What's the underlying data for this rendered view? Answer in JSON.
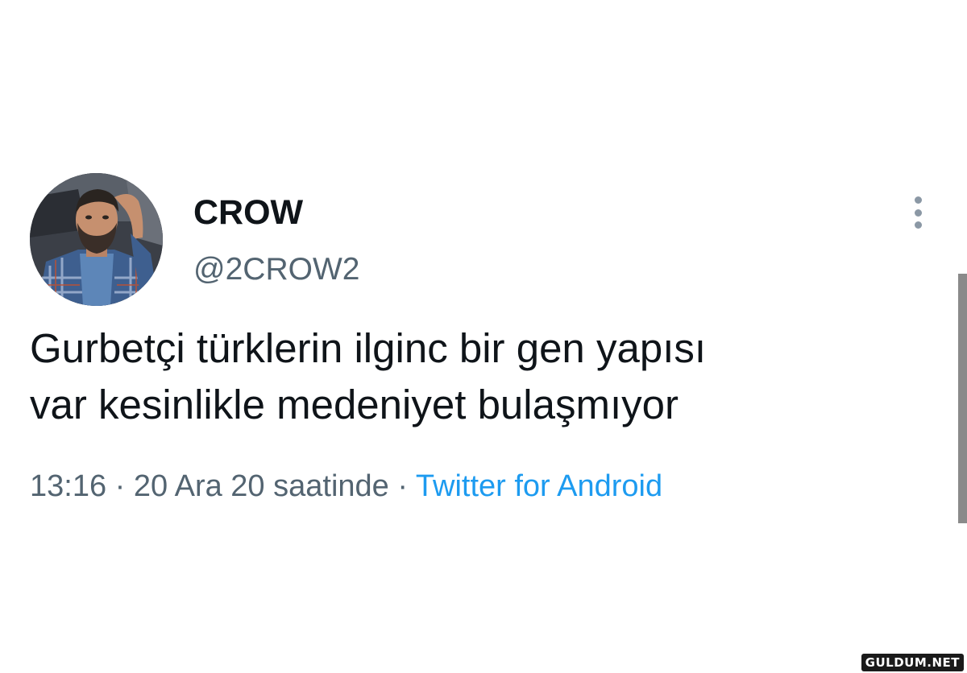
{
  "user": {
    "display_name": "CROW",
    "handle": "@2CROW2",
    "avatar_icon": "profile-photo-avatar"
  },
  "tweet": {
    "text_lines": [
      "Gurbetçi türklerin ilginc bir gen yapısı",
      "var kesinlikle medeniyet bulaşmıyor"
    ],
    "time": "13:16",
    "separator": "·",
    "date": "20 Ara 20 saatinde",
    "source": "Twitter for Android"
  },
  "actions": {
    "more_icon": "more-vertical-icon"
  },
  "watermark": {
    "text": "GULDUM.NET"
  },
  "colors": {
    "text_primary": "#0f1419",
    "text_secondary": "#536471",
    "link": "#1d9bf0"
  }
}
